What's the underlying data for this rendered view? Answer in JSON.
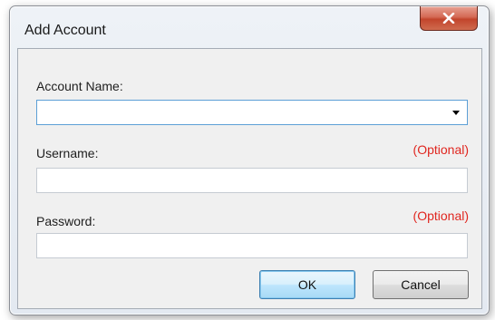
{
  "window": {
    "title": "Add Account",
    "close_glyph": "X"
  },
  "form": {
    "account_name": {
      "label": "Account Name:",
      "value": ""
    },
    "username": {
      "label": "Username:",
      "optional": "(Optional)",
      "value": ""
    },
    "password": {
      "label": "Password:",
      "optional": "(Optional)",
      "value": ""
    }
  },
  "buttons": {
    "ok": "OK",
    "cancel": "Cancel"
  },
  "colors": {
    "optional_text": "#e0261f",
    "focus_border": "#5c9fd6",
    "close_button": "#c2452c"
  },
  "icons": {
    "close": "close-icon",
    "dropdown": "chevron-down-icon"
  }
}
